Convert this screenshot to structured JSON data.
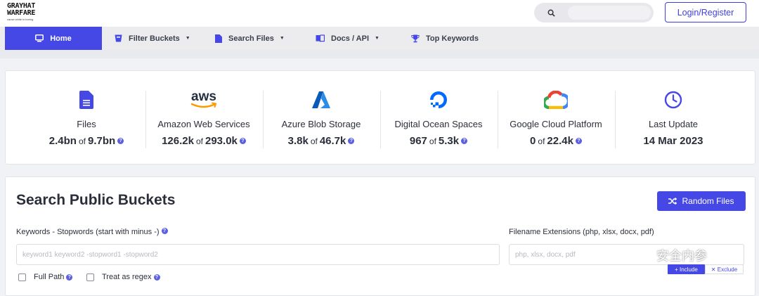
{
  "brand": {
    "line1": "GRAYHAT",
    "line2": "WARFARE",
    "tagline": "cause white is boring"
  },
  "header": {
    "login_label": "Login/Register",
    "search_value": ""
  },
  "nav": {
    "home": "Home",
    "filter_buckets": "Filter Buckets",
    "search_files": "Search Files",
    "docs_api": "Docs / API",
    "top_keywords": "Top Keywords"
  },
  "stats": [
    {
      "title": "Files",
      "value": "2.4bn",
      "of": "of",
      "total": "9.7bn",
      "icon": "file-icon"
    },
    {
      "title": "Amazon Web Services",
      "value": "126.2k",
      "of": "of",
      "total": "293.0k",
      "icon": "aws-logo"
    },
    {
      "title": "Azure Blob Storage",
      "value": "3.8k",
      "of": "of",
      "total": "46.7k",
      "icon": "azure-logo"
    },
    {
      "title": "Digital Ocean Spaces",
      "value": "967",
      "of": "of",
      "total": "5.3k",
      "icon": "digitalocean-logo"
    },
    {
      "title": "Google Cloud Platform",
      "value": "0",
      "of": "of",
      "total": "22.4k",
      "icon": "gcp-logo"
    },
    {
      "title": "Last Update",
      "value": "14 Mar 2023",
      "icon": "clock-icon"
    }
  ],
  "search_panel": {
    "title": "Search Public Buckets",
    "random_label": "Random Files",
    "keywords_label": "Keywords - Stopwords (start with minus -)",
    "keywords_placeholder": "keyword1 keyword2 -stopword1 -stopword2",
    "ext_label": "Filename Extensions (php, xlsx, docx, pdf)",
    "ext_placeholder": "php, xlsx, docx, pdf",
    "full_path": "Full Path",
    "treat_regex": "Treat as regex",
    "include": "Include",
    "exclude": "Exclude"
  },
  "watermark": "安全内参",
  "colors": {
    "accent": "#4548e4",
    "azure": "#0078d4",
    "digitalocean": "#0069ff",
    "aws_orange": "#ff9900"
  }
}
